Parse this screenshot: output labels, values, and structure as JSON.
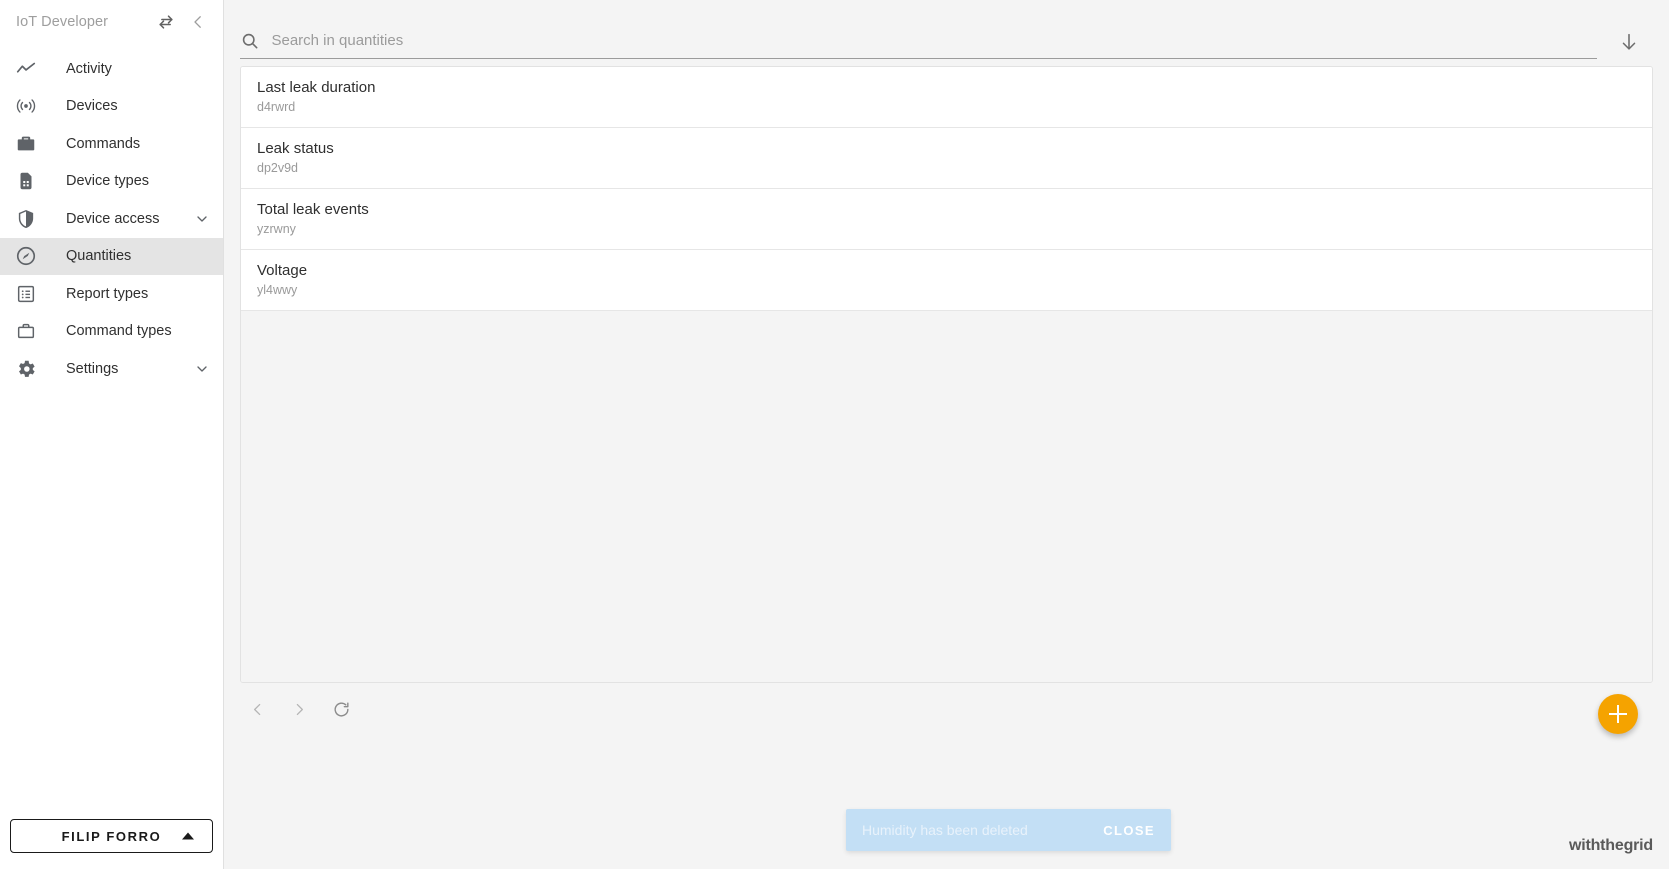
{
  "sidebar": {
    "title": "IoT Developer",
    "header_icons": [
      {
        "name": "swap-icon",
        "glyph": "swap"
      },
      {
        "name": "collapse-icon",
        "glyph": "chevron-left"
      }
    ],
    "items": [
      {
        "label": "Activity",
        "icon": "activity-icon",
        "active": false,
        "expandable": false
      },
      {
        "label": "Devices",
        "icon": "broadcast-icon",
        "active": false,
        "expandable": false
      },
      {
        "label": "Commands",
        "icon": "briefcase-solid-icon",
        "active": false,
        "expandable": false
      },
      {
        "label": "Device types",
        "icon": "sim-card-icon",
        "active": false,
        "expandable": false
      },
      {
        "label": "Device access",
        "icon": "shield-icon",
        "active": false,
        "expandable": true
      },
      {
        "label": "Quantities",
        "icon": "gauge-icon",
        "active": true,
        "expandable": false
      },
      {
        "label": "Report types",
        "icon": "list-box-icon",
        "active": false,
        "expandable": false
      },
      {
        "label": "Command types",
        "icon": "briefcase-outline-icon",
        "active": false,
        "expandable": false
      },
      {
        "label": "Settings",
        "icon": "gear-icon",
        "active": false,
        "expandable": true
      }
    ],
    "user_button": {
      "label": "FILIP FORRO"
    }
  },
  "search": {
    "placeholder": "Search in quantities",
    "value": "",
    "icon": "search-icon"
  },
  "toolbar": {
    "download_icon": "download-icon"
  },
  "list": {
    "items": [
      {
        "title": "Last leak duration",
        "id": "d4rwrd"
      },
      {
        "title": "Leak status",
        "id": "dp2v9d"
      },
      {
        "title": "Total leak events",
        "id": "yzrwny"
      },
      {
        "title": "Voltage",
        "id": "yl4wwy"
      }
    ]
  },
  "pager": {
    "prev_icon": "chevron-left-icon",
    "next_icon": "chevron-right-icon",
    "refresh_icon": "refresh-icon"
  },
  "fab": {
    "icon": "plus-icon",
    "color": "#f5a300"
  },
  "snackbar": {
    "message": "Humidity has been deleted",
    "close_label": "CLOSE",
    "background": "#c3dff5"
  },
  "brand": {
    "name": "withthegrid"
  }
}
